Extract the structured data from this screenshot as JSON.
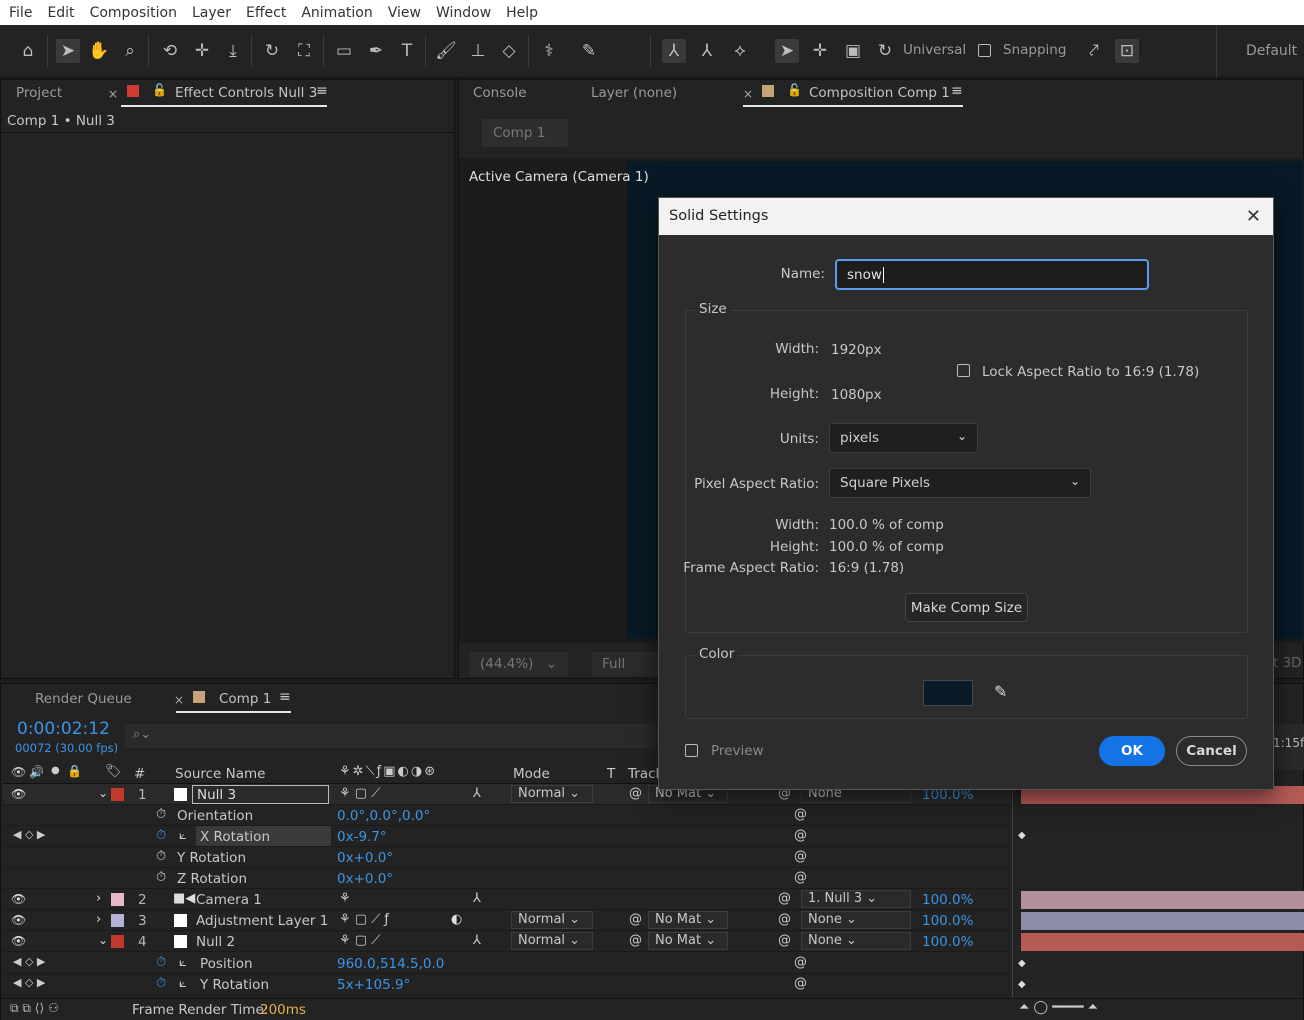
{
  "menu": [
    "File",
    "Edit",
    "Composition",
    "Layer",
    "Effect",
    "Animation",
    "View",
    "Window",
    "Help"
  ],
  "toolbar": {
    "universal": "Universal",
    "snapping": "Snapping",
    "workspace": "Default"
  },
  "left_panel": {
    "tab_project": "Project",
    "tab_effect": "Effect Controls Null 3",
    "breadcrumb": "Comp 1 • Null 3"
  },
  "comp_panel": {
    "tab_console": "Console",
    "tab_layer": "Layer (none)",
    "tab_comp": "Composition Comp 1",
    "subtab": "Comp 1",
    "viewer_label": "Active Camera (Camera 1)",
    "zoom": "(44.4%)",
    "resolution": "Full",
    "right_label": "t 3D"
  },
  "dialog": {
    "title": "Solid Settings",
    "name_label": "Name:",
    "name_value": "snow",
    "size_legend": "Size",
    "width_label": "Width:",
    "width_value": "1920",
    "width_unit": "px",
    "height_label": "Height:",
    "height_value": "1080",
    "height_unit": "px",
    "lock_label": "Lock Aspect Ratio to 16:9 (1.78)",
    "units_label": "Units:",
    "units_value": "pixels",
    "par_label": "Pixel Aspect Ratio:",
    "par_value": "Square Pixels",
    "pct_width_label": "Width:",
    "pct_width_value": "100.0 % of comp",
    "pct_height_label": "Height:",
    "pct_height_value": "100.0 % of comp",
    "far_label": "Frame Aspect Ratio:",
    "far_value": "16:9 (1.78)",
    "make_comp_size": "Make Comp Size",
    "color_legend": "Color",
    "color_value": "#071a26",
    "preview_label": "Preview",
    "ok": "OK",
    "cancel": "Cancel"
  },
  "timeline": {
    "tab_render": "Render Queue",
    "tab_comp": "Comp 1",
    "timecode": "0:00:02:12",
    "frames": "00072 (30.00 fps)",
    "search_placeholder": "",
    "col_num": "#",
    "col_source": "Source Name",
    "col_mode": "Mode",
    "col_t": "T",
    "col_track": "Track",
    "ruler_label": "1:15f",
    "footer_label": "Frame Render Time:",
    "footer_value": "200ms",
    "layers": [
      {
        "num": "1",
        "name": "Null 3",
        "color": "#c0392b",
        "mode": "Normal",
        "track": "No Mat",
        "parent": "None",
        "pct": "100.0%"
      },
      {
        "num": "2",
        "name": "Camera 1",
        "color": "#e5b7c9",
        "parent": "1. Null 3",
        "pct": "100.0%"
      },
      {
        "num": "3",
        "name": "Adjustment Layer 1",
        "color": "#b4b2d6",
        "mode": "Normal",
        "track": "No Mat",
        "parent": "None",
        "pct": "100.0%"
      },
      {
        "num": "4",
        "name": "Null 2",
        "color": "#c0392b",
        "mode": "Normal",
        "track": "No Mat",
        "parent": "None",
        "pct": "100.0%"
      }
    ],
    "props": {
      "orientation": "Orientation",
      "orientation_val": "0.0°,0.0°,0.0°",
      "xrot": "X Rotation",
      "xrot_val": "0x-9.7°",
      "yrot": "Y Rotation",
      "yrot_val": "0x+0.0°",
      "zrot": "Z Rotation",
      "zrot_val": "0x+0.0°",
      "position": "Position",
      "position_val": "960.0,514.5,0.0",
      "yrot2": "Y Rotation",
      "yrot2_val": "5x+105.9°"
    }
  }
}
